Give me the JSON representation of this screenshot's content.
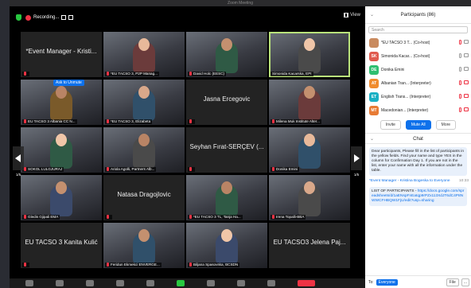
{
  "window": {
    "title": "Zoom Meeting"
  },
  "topbar": {
    "recording_label": "Recording...",
    "view_label": "View"
  },
  "tiles": [
    {
      "name": "*Event Manager - Kristi...",
      "label": "",
      "kind": "named",
      "muted": true
    },
    {
      "name": "",
      "label": "*EU TACSO 3, P2P Manag...",
      "kind": "photo",
      "muted": true
    },
    {
      "name": "",
      "label": "David Holc (EESC)",
      "kind": "photo",
      "muted": true
    },
    {
      "name": "",
      "label": "Simonida Kacarska, EPI",
      "kind": "photo",
      "muted": false
    },
    {
      "name": "",
      "label": "EU TACSO 3 Albania CC N...",
      "kind": "photo",
      "muted": true
    },
    {
      "name": "",
      "label": "*EU TACSO 3, Elizabeta",
      "kind": "photo",
      "muted": true
    },
    {
      "name": "Jasna Ercegovic",
      "label": "",
      "kind": "named",
      "muted": true
    },
    {
      "name": "",
      "label": "Milena Muk Institute Alter...",
      "kind": "photo",
      "muted": true
    },
    {
      "name": "",
      "label": "SOKOL LULGJURAJ",
      "kind": "photo",
      "muted": true
    },
    {
      "name": "",
      "label": "Ariola Agolli, Partners Alb...",
      "kind": "photo",
      "muted": true
    },
    {
      "name": "Seyhan Fırat-SERÇEV (...",
      "label": "",
      "kind": "named",
      "muted": true
    },
    {
      "name": "",
      "label": "Donika Emini",
      "kind": "photo",
      "muted": true
    },
    {
      "name": "",
      "label": "Gledis Gjipali EMA",
      "kind": "photo",
      "muted": true
    },
    {
      "name": "Natasa Dragojlovic",
      "label": "",
      "kind": "named",
      "muted": true
    },
    {
      "name": "",
      "label": "*EU TACSO 3 TL, Tanja Ha...",
      "kind": "photo",
      "muted": true
    },
    {
      "name": "",
      "label": "Irena Topalli-BBA",
      "kind": "photo",
      "muted": true
    },
    {
      "name": "EU TACSO 3 Kanita Kulić",
      "label": "",
      "kind": "named",
      "muted": true
    },
    {
      "name": "",
      "label": "Feridun Ekmekci ENVERGE...",
      "kind": "photo",
      "muted": true
    },
    {
      "name": "",
      "label": "Biljana Spasovska, BCSDN",
      "kind": "photo",
      "muted": true
    },
    {
      "name": "EU TACSO3 Jelena Paj...",
      "label": "",
      "kind": "named",
      "muted": false
    }
  ],
  "unmute_label": "Ask to Unmute",
  "pager": {
    "left": "1/5",
    "right": "1/5"
  },
  "participants": {
    "title": "Participants (86)",
    "search_placeholder": "Search",
    "items": [
      {
        "initials": "",
        "name": "*EU TACSO 3 T... (Co-host)",
        "color": "#c98a5e"
      },
      {
        "initials": "SK",
        "name": "Simonida Kacar... (Co-host)",
        "color": "#e05a4e"
      },
      {
        "initials": "DE",
        "name": "Donika Emini",
        "color": "#2fbf71"
      },
      {
        "initials": "AT",
        "name": "Albanian Tran... (Interpreter)",
        "color": "#f08c2e"
      },
      {
        "initials": "ET",
        "name": "English Trans... (Interpreter)",
        "color": "#1ab0c4"
      },
      {
        "initials": "MT",
        "name": "Macedonian... (Interpreter)",
        "color": "#e77b35"
      }
    ],
    "buttons": {
      "invite": "Invite",
      "mute_all": "Mute All",
      "more": "More"
    }
  },
  "chat": {
    "title": "Chat",
    "message1": "Dear participants, Please fill in the list of participants in the yellow fields. Find your name and type YES in the column for Confirmation Day 1. If you are not in the list, enter your name with all the information under the table.",
    "sender": "*Event Manager - Kristina Bogeska to Everyone",
    "time": "10:33",
    "message2_prefix": "LIST OF PARTICIPANTS - ",
    "message2_link": "https://docs.google.com/spreadsheets/d/1aENspFnEatqp9rPZx113XdJT6dC4P8NWWCFHBQW1FjU/edit?usp=sharing",
    "to_label": "To:",
    "to_value": "Everyone",
    "file_label": "File",
    "more_label": "..."
  }
}
